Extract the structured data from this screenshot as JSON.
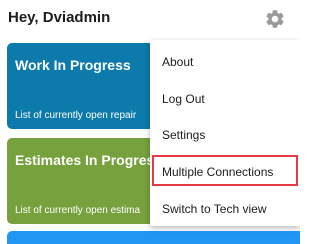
{
  "header": {
    "greeting": "Hey, Dviadmin",
    "settings_icon": "gear-icon"
  },
  "cards": [
    {
      "title": "Work In Progress",
      "description": "List of currently open repair",
      "color": "#0c7aab"
    },
    {
      "title": "Estimates In Progress",
      "description": "List of currently open estima",
      "color": "#76a13d"
    },
    {
      "color": "#2196f3"
    }
  ],
  "menu": {
    "items": [
      "About",
      "Log Out",
      "Settings",
      "Multiple Connections",
      "Switch to Tech view"
    ],
    "highlighted": "Multiple Connections",
    "highlight_color": "#e53945"
  }
}
